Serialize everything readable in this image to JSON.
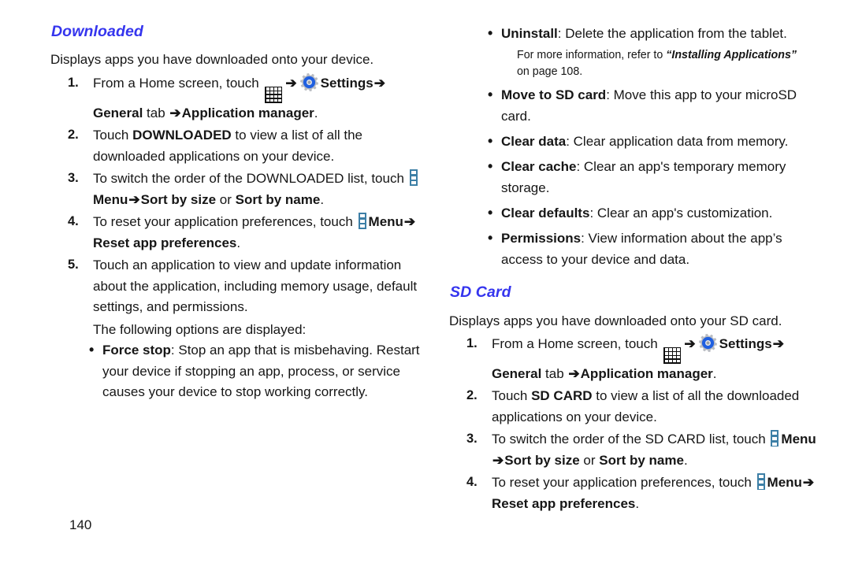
{
  "document": {
    "page_number": "140",
    "accent_heading_color": "#3535ee",
    "menu_icon_color": "#3d7fa6",
    "gear_accent_color": "#1f5fe0"
  },
  "icons": {
    "apps_grid": "apps-grid-icon",
    "settings_gear": "settings-gear-icon",
    "menu_dots": "menu-dots-icon",
    "arrow": "➔"
  },
  "left_column": {
    "heading": "Downloaded",
    "intro": "Displays apps you have downloaded onto your device.",
    "steps": [
      {
        "num": "1.",
        "parts": [
          {
            "type": "text",
            "value": "From a Home screen, touch "
          },
          {
            "type": "icon",
            "value": "apps-grid-icon"
          },
          {
            "type": "arrow",
            "value": "➔"
          },
          {
            "type": "icon",
            "value": "settings-gear-icon"
          },
          {
            "type": "bold",
            "value": "Settings"
          },
          {
            "type": "arrow",
            "value": "➔"
          },
          {
            "type": "bold",
            "value": "General"
          },
          {
            "type": "text",
            "value": " tab "
          },
          {
            "type": "arrow",
            "value": "➔"
          },
          {
            "type": "bold",
            "value": "Application manager"
          },
          {
            "type": "text",
            "value": "."
          }
        ]
      },
      {
        "num": "2.",
        "parts": [
          {
            "type": "text",
            "value": "Touch "
          },
          {
            "type": "bold",
            "value": "DOWNLOADED"
          },
          {
            "type": "text",
            "value": " to view a list of all the downloaded applications on your device."
          }
        ]
      },
      {
        "num": "3.",
        "parts": [
          {
            "type": "text",
            "value": "To switch the order of the DOWNLOADED list, touch "
          },
          {
            "type": "icon",
            "value": "menu-dots-icon"
          },
          {
            "type": "bold",
            "value": "Menu"
          },
          {
            "type": "arrow",
            "value": "➔"
          },
          {
            "type": "bold",
            "value": "Sort by size"
          },
          {
            "type": "text",
            "value": " or "
          },
          {
            "type": "bold",
            "value": "Sort by name"
          },
          {
            "type": "text",
            "value": "."
          }
        ]
      },
      {
        "num": "4.",
        "parts": [
          {
            "type": "text",
            "value": "To reset your application preferences, touch "
          },
          {
            "type": "icon",
            "value": "menu-dots-icon"
          },
          {
            "type": "bold",
            "value": "Menu"
          },
          {
            "type": "arrow",
            "value": "➔"
          },
          {
            "type": "bold",
            "value": "Reset app preferences"
          },
          {
            "type": "text",
            "value": "."
          }
        ]
      },
      {
        "num": "5.",
        "parts": [
          {
            "type": "text",
            "value": "Touch an application to view and update information about the application, including memory usage, default settings, and permissions."
          }
        ]
      }
    ],
    "substep_text": "The following options are displayed:",
    "options": [
      {
        "term": "Force stop",
        "desc": ": Stop an app that is misbehaving. Restart your device if stopping an app, process, or service causes your device to stop working correctly."
      }
    ]
  },
  "right_column": {
    "options": [
      {
        "term": "Uninstall",
        "desc": ": Delete the application from the tablet."
      },
      {
        "term": "Move to SD card",
        "desc": ": Move this app to your microSD card."
      },
      {
        "term": "Clear data",
        "desc": ": Clear application data from memory."
      },
      {
        "term": "Clear cache",
        "desc": ": Clear an app's temporary memory storage."
      },
      {
        "term": "Clear defaults",
        "desc": ": Clear an app's customization."
      },
      {
        "term": "Permissions",
        "desc": ": View information about the app’s access to your device and data."
      }
    ],
    "uninstall_note": {
      "lead": "For more information, refer to ",
      "title": "“Installing Applications”",
      "tail": " on page 108."
    },
    "heading": "SD Card",
    "intro": "Displays apps you have downloaded onto your SD card.",
    "steps": [
      {
        "num": "1.",
        "parts": [
          {
            "type": "text",
            "value": "From a Home screen, touch "
          },
          {
            "type": "icon",
            "value": "apps-grid-icon"
          },
          {
            "type": "arrow",
            "value": "➔"
          },
          {
            "type": "icon",
            "value": "settings-gear-icon"
          },
          {
            "type": "bold",
            "value": "Settings"
          },
          {
            "type": "arrow",
            "value": "➔"
          },
          {
            "type": "bold",
            "value": "General"
          },
          {
            "type": "text",
            "value": " tab "
          },
          {
            "type": "arrow",
            "value": "➔"
          },
          {
            "type": "bold",
            "value": "Application manager"
          },
          {
            "type": "text",
            "value": "."
          }
        ]
      },
      {
        "num": "2.",
        "parts": [
          {
            "type": "text",
            "value": "Touch "
          },
          {
            "type": "bold",
            "value": "SD CARD"
          },
          {
            "type": "text",
            "value": " to view a list of all the downloaded applications on your device."
          }
        ]
      },
      {
        "num": "3.",
        "parts": [
          {
            "type": "text",
            "value": "To switch the order of the SD CARD list, touch "
          },
          {
            "type": "icon",
            "value": "menu-dots-icon"
          },
          {
            "type": "bold",
            "value": "Menu"
          },
          {
            "type": "arrow",
            "value": "➔"
          },
          {
            "type": "bold",
            "value": "Sort by size"
          },
          {
            "type": "text",
            "value": " or "
          },
          {
            "type": "bold",
            "value": "Sort by name"
          },
          {
            "type": "text",
            "value": "."
          }
        ]
      },
      {
        "num": "4.",
        "parts": [
          {
            "type": "text",
            "value": "To reset your application preferences, touch "
          },
          {
            "type": "icon",
            "value": "menu-dots-icon"
          },
          {
            "type": "bold",
            "value": "Menu"
          },
          {
            "type": "arrow",
            "value": "➔"
          },
          {
            "type": "bold",
            "value": "Reset app preferences"
          },
          {
            "type": "text",
            "value": "."
          }
        ]
      }
    ]
  }
}
